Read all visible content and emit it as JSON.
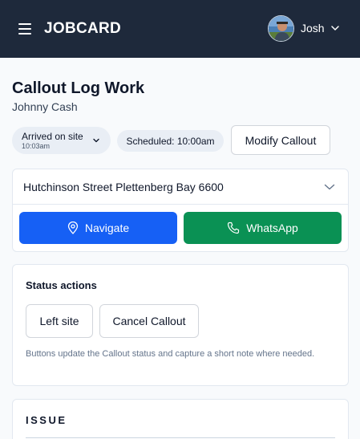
{
  "header": {
    "brand": "JOBCARD",
    "user_name": "Josh",
    "icons": [
      "hamburger-menu-icon",
      "avatar",
      "chevron-down-icon"
    ],
    "background": "#1e293b"
  },
  "page": {
    "title": "Callout Log Work",
    "subtitle": "Johnny Cash"
  },
  "status_bar": {
    "status_label": "Arrived on site",
    "status_time": "10:03am",
    "scheduled_label": "Scheduled: 10:00am",
    "modify_label": "Modify Callout"
  },
  "address": {
    "text": "Hutchinson Street Plettenberg Bay 6600",
    "navigate_label": "Navigate",
    "whatsapp_label": "WhatsApp",
    "navigate_color": "#1660f5",
    "whatsapp_color": "#0a9154"
  },
  "status_actions": {
    "heading": "Status actions",
    "buttons": [
      {
        "label": "Left site"
      },
      {
        "label": "Cancel Callout"
      }
    ],
    "help": "Buttons update the Callout status and capture a short note where needed."
  },
  "issue": {
    "heading": "ISSUE"
  }
}
